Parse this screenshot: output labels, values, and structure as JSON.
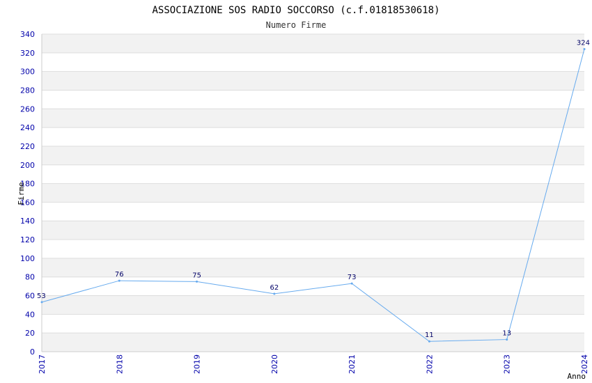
{
  "chart_data": {
    "type": "line",
    "title": "ASSOCIAZIONE SOS RADIO SOCCORSO (c.f.01818530618)",
    "subtitle": "Numero Firme",
    "xlabel": "Anno",
    "ylabel": "Firme",
    "x": [
      "2017",
      "2018",
      "2019",
      "2020",
      "2021",
      "2022",
      "2023",
      "2024"
    ],
    "series": [
      {
        "values": [
          53,
          76,
          75,
          62,
          73,
          11,
          13,
          324
        ]
      }
    ],
    "ylim": [
      0,
      340
    ],
    "ystep": 20,
    "grid": true,
    "colors": {
      "line": "#66aaee",
      "band": "#f2f2f2",
      "gridline": "#dddddd",
      "tick_text": "#0000aa",
      "data_label": "#000066"
    }
  }
}
